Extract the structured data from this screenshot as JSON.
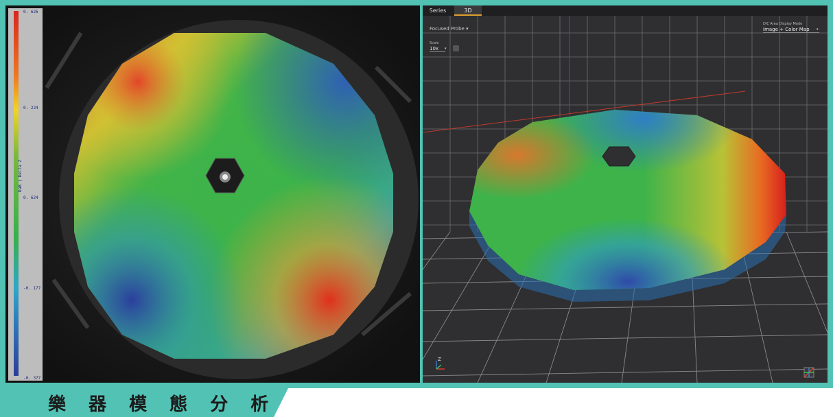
{
  "colorbar": {
    "title": "DaB | Delta Z",
    "ticks": [
      "0. 626",
      "0. 224",
      "0. 624",
      "-0. 177",
      "-0. 377"
    ]
  },
  "viewer3d": {
    "tabs": [
      "Series",
      "3D"
    ],
    "active_tab": "3D",
    "probe_select": "Focused Probe",
    "scale_label": "Scale",
    "scale_value": "10x",
    "display_mode_label": "DIC Area Display Mode",
    "display_mode_value": "Image + Color Map",
    "axis_label": "Z"
  },
  "banner": {
    "title": "樂 器 模 態 分 析"
  },
  "colors": {
    "frame_teal": "#52c2b4",
    "tab_accent": "#e0a030"
  }
}
